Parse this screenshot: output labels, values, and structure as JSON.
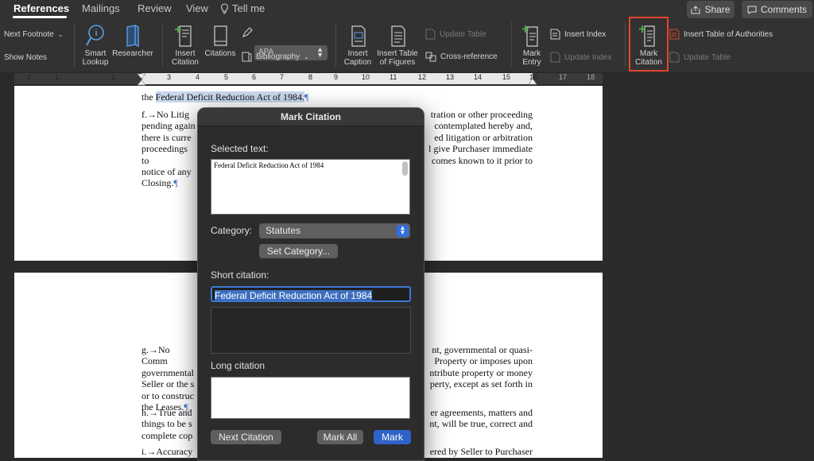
{
  "tabs": [
    {
      "label": "References",
      "active": true
    },
    {
      "label": "Mailings",
      "active": false
    },
    {
      "label": "Review",
      "active": false
    },
    {
      "label": "View",
      "active": false
    }
  ],
  "tell_me": "Tell me",
  "share_label": "Share",
  "comments_label": "Comments",
  "ribbon": {
    "next_footnote": "Next Footnote",
    "show_notes": "Show Notes",
    "smart_lookup": [
      "Smart",
      "Lookup"
    ],
    "researcher": "Researcher",
    "insert_citation": [
      "Insert",
      "Citation"
    ],
    "citations": "Citations",
    "style_value": "APA",
    "bibliography": "Bibliography",
    "insert_caption": [
      "Insert",
      "Caption"
    ],
    "insert_table_figures": [
      "Insert Table",
      "of Figures"
    ],
    "update_table": "Update Table",
    "cross_reference": "Cross-reference",
    "mark_entry": [
      "Mark",
      "Entry"
    ],
    "insert_index": "Insert Index",
    "update_index": "Update Index",
    "mark_citation": [
      "Mark",
      "Citation"
    ],
    "insert_toa": "Insert Table of Authorities",
    "update_table_toa": "Update Table"
  },
  "ruler_numbers": [
    "2",
    "1",
    "1",
    "2",
    "3",
    "4",
    "5",
    "6",
    "7",
    "8",
    "9",
    "10",
    "11",
    "12",
    "13",
    "14",
    "15",
    "16",
    "17",
    "18"
  ],
  "page1": {
    "line_top": "the ",
    "act_name": "Federal Deficit Reduction Act of 1984.",
    "pilcrow": "¶",
    "para_f_left": [
      "f.→No Litig",
      "pending again",
      "there is curre",
      "proceedings to",
      "notice of any",
      "Closing."
    ],
    "para_f_right": [
      "tration or other proceeding",
      "contemplated hereby and,",
      "ed litigation or arbitration",
      "l give Purchaser immediate",
      "comes known to it prior to"
    ]
  },
  "page2": {
    "para_g_left": [
      "g.→No Comm",
      "governmental",
      "Seller or the s",
      "or to construc",
      "the Leases."
    ],
    "para_g_right": [
      "nt, governmental or quasi-",
      "Property or imposes upon",
      "ntribute property or money",
      "perty, except as set forth in"
    ],
    "para_h_left": [
      "h.→True and",
      "things to be s",
      "complete cop"
    ],
    "para_h_right": [
      "er agreements, matters and",
      "nt, will be true, correct and"
    ],
    "para_i_left": "i.→Accuracy",
    "para_i_right": "ered by Seller to Purchaser"
  },
  "dialog": {
    "title": "Mark Citation",
    "selected_text_label": "Selected text:",
    "selected_text": "Federal Deficit Reduction Act of 1984",
    "category_label": "Category:",
    "category_value": "Statutes",
    "set_category": "Set Category...",
    "short_citation_label": "Short citation:",
    "short_citation_value": "Federal Deficit Reduction Act of 1984",
    "long_citation_label": "Long citation",
    "next_citation": "Next Citation",
    "mark_all": "Mark All",
    "mark": "Mark"
  }
}
